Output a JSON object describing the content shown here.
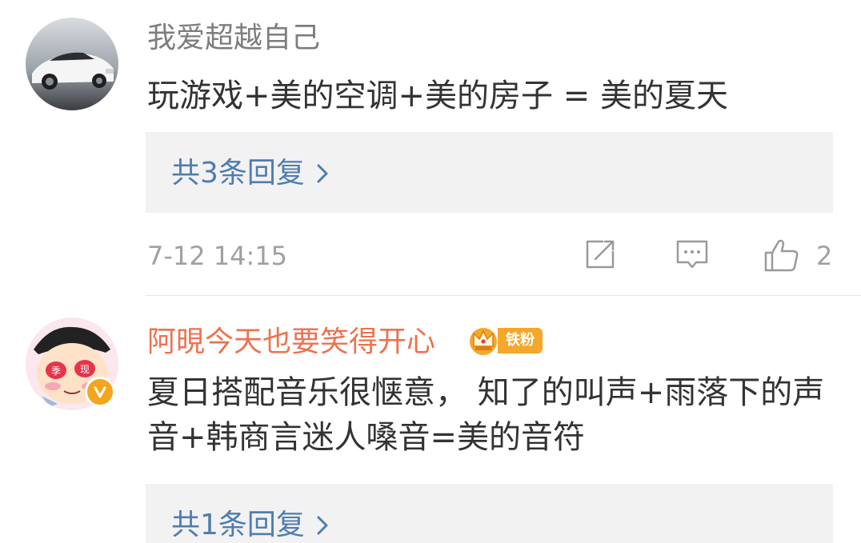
{
  "comments": [
    {
      "username": "我爱超越自己",
      "text": "玩游戏+美的空调+美的房子 = 美的夏天",
      "reply_link": "共3条回复",
      "time": "7-12 14:15",
      "like_count": "2"
    },
    {
      "username": "阿晛今天也要笑得开心",
      "fan_badge": "铁粉",
      "text": "夏日搭配音乐很惬意， 知了的叫声+雨落下的声音+韩商言迷人嗓音=美的音符",
      "reply_link": "共1条回复"
    }
  ],
  "icons": {
    "share": "share-icon",
    "comment": "comment-icon",
    "like": "thumbs-up-icon",
    "chevron": "chevron-right-icon",
    "crown": "crown-icon",
    "verified": "verified-v-icon"
  },
  "colors": {
    "username_gray": "#7d7d7d",
    "username_vip": "#eb7350",
    "link_blue": "#507daf",
    "reply_bg": "#f2f2f2",
    "meta_gray": "#a0a0a0",
    "badge_orange": "#f4a72a"
  }
}
